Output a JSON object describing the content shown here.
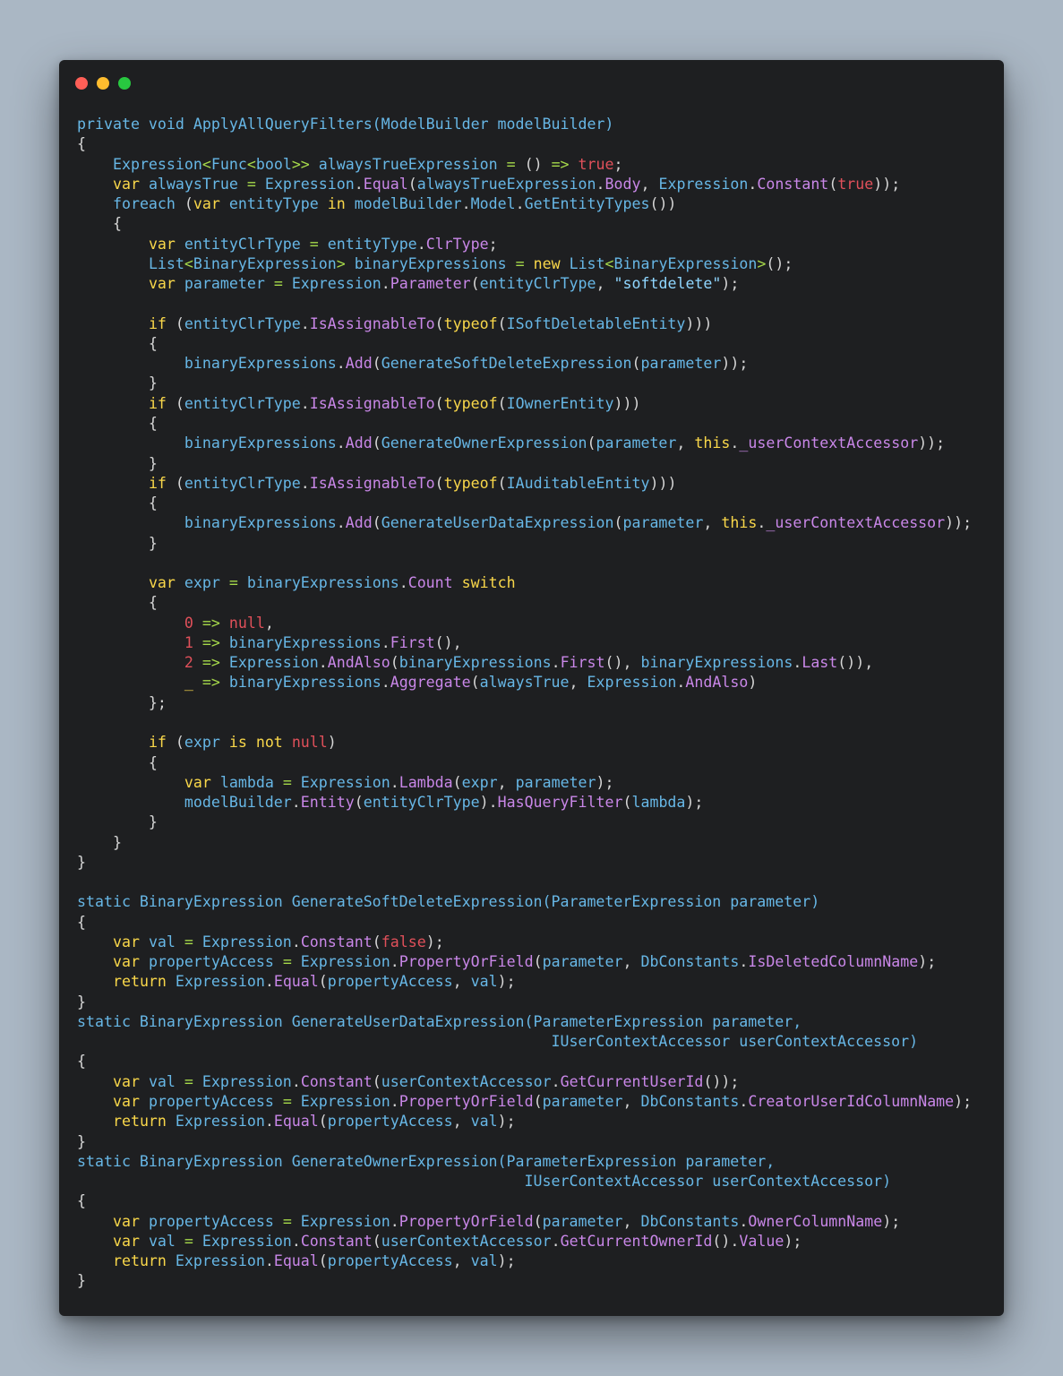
{
  "window": {
    "buttons": [
      {
        "name": "close",
        "color": "#ff5f57"
      },
      {
        "name": "minimize",
        "color": "#febc2e"
      },
      {
        "name": "maximize",
        "color": "#28c840"
      }
    ]
  },
  "theme": {
    "k": "#f9d74a",
    "t": "#67b7e6",
    "m": "#c987e8",
    "b": "#e0505a",
    "g": "#a6d94a",
    "s": "#8fd6ff",
    "p": "#d6d6d6"
  },
  "code": [
    [
      [
        "t",
        "private void ApplyAllQueryFilters(ModelBuilder modelBuilder)"
      ]
    ],
    [
      [
        "p",
        "{"
      ]
    ],
    [
      [
        "p",
        "    "
      ],
      [
        "t",
        "Expression"
      ],
      [
        "g",
        "<"
      ],
      [
        "t",
        "Func"
      ],
      [
        "g",
        "<"
      ],
      [
        "t",
        "bool"
      ],
      [
        "g",
        ">>"
      ],
      [
        "t",
        " alwaysTrueExpression "
      ],
      [
        "g",
        "="
      ],
      [
        "p",
        " () "
      ],
      [
        "g",
        "=>"
      ],
      [
        "p",
        " "
      ],
      [
        "b",
        "true"
      ],
      [
        "p",
        ";"
      ]
    ],
    [
      [
        "p",
        "    "
      ],
      [
        "k",
        "var"
      ],
      [
        "t",
        " alwaysTrue "
      ],
      [
        "g",
        "="
      ],
      [
        "t",
        " Expression"
      ],
      [
        "p",
        "."
      ],
      [
        "m",
        "Equal"
      ],
      [
        "p",
        "("
      ],
      [
        "t",
        "alwaysTrueExpression"
      ],
      [
        "p",
        "."
      ],
      [
        "m",
        "Body"
      ],
      [
        "p",
        ", "
      ],
      [
        "t",
        "Expression"
      ],
      [
        "p",
        "."
      ],
      [
        "m",
        "Constant"
      ],
      [
        "p",
        "("
      ],
      [
        "b",
        "true"
      ],
      [
        "p",
        "));"
      ]
    ],
    [
      [
        "p",
        "    "
      ],
      [
        "t",
        "foreach"
      ],
      [
        "p",
        " ("
      ],
      [
        "k",
        "var"
      ],
      [
        "t",
        " entityType "
      ],
      [
        "k",
        "in"
      ],
      [
        "t",
        " modelBuilder"
      ],
      [
        "p",
        "."
      ],
      [
        "t",
        "Model"
      ],
      [
        "p",
        "."
      ],
      [
        "t",
        "GetEntityTypes"
      ],
      [
        "p",
        "())"
      ]
    ],
    [
      [
        "p",
        "    {"
      ]
    ],
    [
      [
        "p",
        "        "
      ],
      [
        "k",
        "var"
      ],
      [
        "t",
        " entityClrType "
      ],
      [
        "g",
        "="
      ],
      [
        "t",
        " entityType"
      ],
      [
        "p",
        "."
      ],
      [
        "m",
        "ClrType"
      ],
      [
        "p",
        ";"
      ]
    ],
    [
      [
        "p",
        "        "
      ],
      [
        "t",
        "List"
      ],
      [
        "g",
        "<"
      ],
      [
        "t",
        "BinaryExpression"
      ],
      [
        "g",
        ">"
      ],
      [
        "t",
        " binaryExpressions "
      ],
      [
        "g",
        "="
      ],
      [
        "p",
        " "
      ],
      [
        "k",
        "new"
      ],
      [
        "p",
        " "
      ],
      [
        "t",
        "List"
      ],
      [
        "g",
        "<"
      ],
      [
        "t",
        "BinaryExpression"
      ],
      [
        "g",
        ">"
      ],
      [
        "p",
        "();"
      ]
    ],
    [
      [
        "p",
        "        "
      ],
      [
        "k",
        "var"
      ],
      [
        "t",
        " parameter "
      ],
      [
        "g",
        "="
      ],
      [
        "t",
        " Expression"
      ],
      [
        "p",
        "."
      ],
      [
        "m",
        "Parameter"
      ],
      [
        "p",
        "("
      ],
      [
        "t",
        "entityClrType"
      ],
      [
        "p",
        ", "
      ],
      [
        "s",
        "\"softdelete\""
      ],
      [
        "p",
        ");"
      ]
    ],
    [
      [
        "p",
        ""
      ]
    ],
    [
      [
        "p",
        "        "
      ],
      [
        "k",
        "if"
      ],
      [
        "p",
        " ("
      ],
      [
        "t",
        "entityClrType"
      ],
      [
        "p",
        "."
      ],
      [
        "m",
        "IsAssignableTo"
      ],
      [
        "p",
        "("
      ],
      [
        "k",
        "typeof"
      ],
      [
        "p",
        "("
      ],
      [
        "t",
        "ISoftDeletableEntity"
      ],
      [
        "p",
        ")))"
      ]
    ],
    [
      [
        "p",
        "        {"
      ]
    ],
    [
      [
        "p",
        "            "
      ],
      [
        "t",
        "binaryExpressions"
      ],
      [
        "p",
        "."
      ],
      [
        "m",
        "Add"
      ],
      [
        "p",
        "("
      ],
      [
        "t",
        "GenerateSoftDeleteExpression"
      ],
      [
        "p",
        "("
      ],
      [
        "t",
        "parameter"
      ],
      [
        "p",
        "));"
      ]
    ],
    [
      [
        "p",
        "        }"
      ]
    ],
    [
      [
        "p",
        "        "
      ],
      [
        "k",
        "if"
      ],
      [
        "p",
        " ("
      ],
      [
        "t",
        "entityClrType"
      ],
      [
        "p",
        "."
      ],
      [
        "m",
        "IsAssignableTo"
      ],
      [
        "p",
        "("
      ],
      [
        "k",
        "typeof"
      ],
      [
        "p",
        "("
      ],
      [
        "t",
        "IOwnerEntity"
      ],
      [
        "p",
        ")))"
      ]
    ],
    [
      [
        "p",
        "        {"
      ]
    ],
    [
      [
        "p",
        "            "
      ],
      [
        "t",
        "binaryExpressions"
      ],
      [
        "p",
        "."
      ],
      [
        "m",
        "Add"
      ],
      [
        "p",
        "("
      ],
      [
        "t",
        "GenerateOwnerExpression"
      ],
      [
        "p",
        "("
      ],
      [
        "t",
        "parameter"
      ],
      [
        "p",
        ", "
      ],
      [
        "k",
        "this"
      ],
      [
        "p",
        "."
      ],
      [
        "m",
        "_userContextAccessor"
      ],
      [
        "p",
        "));"
      ]
    ],
    [
      [
        "p",
        "        }"
      ]
    ],
    [
      [
        "p",
        "        "
      ],
      [
        "k",
        "if"
      ],
      [
        "p",
        " ("
      ],
      [
        "t",
        "entityClrType"
      ],
      [
        "p",
        "."
      ],
      [
        "m",
        "IsAssignableTo"
      ],
      [
        "p",
        "("
      ],
      [
        "k",
        "typeof"
      ],
      [
        "p",
        "("
      ],
      [
        "t",
        "IAuditableEntity"
      ],
      [
        "p",
        ")))"
      ]
    ],
    [
      [
        "p",
        "        {"
      ]
    ],
    [
      [
        "p",
        "            "
      ],
      [
        "t",
        "binaryExpressions"
      ],
      [
        "p",
        "."
      ],
      [
        "m",
        "Add"
      ],
      [
        "p",
        "("
      ],
      [
        "t",
        "GenerateUserDataExpression"
      ],
      [
        "p",
        "("
      ],
      [
        "t",
        "parameter"
      ],
      [
        "p",
        ", "
      ],
      [
        "k",
        "this"
      ],
      [
        "p",
        "."
      ],
      [
        "m",
        "_userContextAccessor"
      ],
      [
        "p",
        "));"
      ]
    ],
    [
      [
        "p",
        "        }"
      ]
    ],
    [
      [
        "p",
        ""
      ]
    ],
    [
      [
        "p",
        "        "
      ],
      [
        "k",
        "var"
      ],
      [
        "t",
        " expr "
      ],
      [
        "g",
        "="
      ],
      [
        "t",
        " binaryExpressions"
      ],
      [
        "p",
        "."
      ],
      [
        "m",
        "Count"
      ],
      [
        "p",
        " "
      ],
      [
        "k",
        "switch"
      ]
    ],
    [
      [
        "p",
        "        {"
      ]
    ],
    [
      [
        "p",
        "            "
      ],
      [
        "b",
        "0"
      ],
      [
        "p",
        " "
      ],
      [
        "g",
        "=>"
      ],
      [
        "p",
        " "
      ],
      [
        "b",
        "null"
      ],
      [
        "p",
        ","
      ]
    ],
    [
      [
        "p",
        "            "
      ],
      [
        "b",
        "1"
      ],
      [
        "p",
        " "
      ],
      [
        "g",
        "=>"
      ],
      [
        "t",
        " binaryExpressions"
      ],
      [
        "p",
        "."
      ],
      [
        "m",
        "First"
      ],
      [
        "p",
        "(),"
      ]
    ],
    [
      [
        "p",
        "            "
      ],
      [
        "b",
        "2"
      ],
      [
        "p",
        " "
      ],
      [
        "g",
        "=>"
      ],
      [
        "t",
        " Expression"
      ],
      [
        "p",
        "."
      ],
      [
        "m",
        "AndAlso"
      ],
      [
        "p",
        "("
      ],
      [
        "t",
        "binaryExpressions"
      ],
      [
        "p",
        "."
      ],
      [
        "m",
        "First"
      ],
      [
        "p",
        "(), "
      ],
      [
        "t",
        "binaryExpressions"
      ],
      [
        "p",
        "."
      ],
      [
        "m",
        "Last"
      ],
      [
        "p",
        "()),"
      ]
    ],
    [
      [
        "p",
        "            "
      ],
      [
        "k",
        "_"
      ],
      [
        "p",
        " "
      ],
      [
        "g",
        "=>"
      ],
      [
        "t",
        " binaryExpressions"
      ],
      [
        "p",
        "."
      ],
      [
        "m",
        "Aggregate"
      ],
      [
        "p",
        "("
      ],
      [
        "t",
        "alwaysTrue"
      ],
      [
        "p",
        ", "
      ],
      [
        "t",
        "Expression"
      ],
      [
        "p",
        "."
      ],
      [
        "m",
        "AndAlso"
      ],
      [
        "p",
        ")"
      ]
    ],
    [
      [
        "p",
        "        };"
      ]
    ],
    [
      [
        "p",
        ""
      ]
    ],
    [
      [
        "p",
        "        "
      ],
      [
        "k",
        "if"
      ],
      [
        "p",
        " ("
      ],
      [
        "t",
        "expr "
      ],
      [
        "k",
        "is not"
      ],
      [
        "p",
        " "
      ],
      [
        "b",
        "null"
      ],
      [
        "p",
        ")"
      ]
    ],
    [
      [
        "p",
        "        {"
      ]
    ],
    [
      [
        "p",
        "            "
      ],
      [
        "k",
        "var"
      ],
      [
        "t",
        " lambda "
      ],
      [
        "g",
        "="
      ],
      [
        "t",
        " Expression"
      ],
      [
        "p",
        "."
      ],
      [
        "m",
        "Lambda"
      ],
      [
        "p",
        "("
      ],
      [
        "t",
        "expr"
      ],
      [
        "p",
        ", "
      ],
      [
        "t",
        "parameter"
      ],
      [
        "p",
        ");"
      ]
    ],
    [
      [
        "p",
        "            "
      ],
      [
        "t",
        "modelBuilder"
      ],
      [
        "p",
        "."
      ],
      [
        "m",
        "Entity"
      ],
      [
        "p",
        "("
      ],
      [
        "t",
        "entityClrType"
      ],
      [
        "p",
        ")."
      ],
      [
        "m",
        "HasQueryFilter"
      ],
      [
        "p",
        "("
      ],
      [
        "t",
        "lambda"
      ],
      [
        "p",
        ");"
      ]
    ],
    [
      [
        "p",
        "        }"
      ]
    ],
    [
      [
        "p",
        "    }"
      ]
    ],
    [
      [
        "p",
        "}"
      ]
    ],
    [
      [
        "p",
        ""
      ]
    ],
    [
      [
        "t",
        "static BinaryExpression GenerateSoftDeleteExpression(ParameterExpression parameter)"
      ]
    ],
    [
      [
        "p",
        "{"
      ]
    ],
    [
      [
        "p",
        "    "
      ],
      [
        "k",
        "var"
      ],
      [
        "t",
        " val "
      ],
      [
        "g",
        "="
      ],
      [
        "t",
        " Expression"
      ],
      [
        "p",
        "."
      ],
      [
        "m",
        "Constant"
      ],
      [
        "p",
        "("
      ],
      [
        "b",
        "false"
      ],
      [
        "p",
        ");"
      ]
    ],
    [
      [
        "p",
        "    "
      ],
      [
        "k",
        "var"
      ],
      [
        "t",
        " propertyAccess "
      ],
      [
        "g",
        "="
      ],
      [
        "t",
        " Expression"
      ],
      [
        "p",
        "."
      ],
      [
        "m",
        "PropertyOrField"
      ],
      [
        "p",
        "("
      ],
      [
        "t",
        "parameter"
      ],
      [
        "p",
        ", "
      ],
      [
        "t",
        "DbConstants"
      ],
      [
        "p",
        "."
      ],
      [
        "m",
        "IsDeletedColumnName"
      ],
      [
        "p",
        ");"
      ]
    ],
    [
      [
        "p",
        "    "
      ],
      [
        "k",
        "return"
      ],
      [
        "t",
        " Expression"
      ],
      [
        "p",
        "."
      ],
      [
        "m",
        "Equal"
      ],
      [
        "p",
        "("
      ],
      [
        "t",
        "propertyAccess"
      ],
      [
        "p",
        ", "
      ],
      [
        "t",
        "val"
      ],
      [
        "p",
        ");"
      ]
    ],
    [
      [
        "p",
        "}"
      ]
    ],
    [
      [
        "t",
        "static BinaryExpression GenerateUserDataExpression(ParameterExpression parameter,"
      ]
    ],
    [
      [
        "t",
        "                                                     IUserContextAccessor userContextAccessor)"
      ]
    ],
    [
      [
        "p",
        "{"
      ]
    ],
    [
      [
        "p",
        "    "
      ],
      [
        "k",
        "var"
      ],
      [
        "t",
        " val "
      ],
      [
        "g",
        "="
      ],
      [
        "t",
        " Expression"
      ],
      [
        "p",
        "."
      ],
      [
        "m",
        "Constant"
      ],
      [
        "p",
        "("
      ],
      [
        "t",
        "userContextAccessor"
      ],
      [
        "p",
        "."
      ],
      [
        "m",
        "GetCurrentUserId"
      ],
      [
        "p",
        "());"
      ]
    ],
    [
      [
        "p",
        "    "
      ],
      [
        "k",
        "var"
      ],
      [
        "t",
        " propertyAccess "
      ],
      [
        "g",
        "="
      ],
      [
        "t",
        " Expression"
      ],
      [
        "p",
        "."
      ],
      [
        "m",
        "PropertyOrField"
      ],
      [
        "p",
        "("
      ],
      [
        "t",
        "parameter"
      ],
      [
        "p",
        ", "
      ],
      [
        "t",
        "DbConstants"
      ],
      [
        "p",
        "."
      ],
      [
        "m",
        "CreatorUserIdColumnName"
      ],
      [
        "p",
        ");"
      ]
    ],
    [
      [
        "p",
        "    "
      ],
      [
        "k",
        "return"
      ],
      [
        "t",
        " Expression"
      ],
      [
        "p",
        "."
      ],
      [
        "m",
        "Equal"
      ],
      [
        "p",
        "("
      ],
      [
        "t",
        "propertyAccess"
      ],
      [
        "p",
        ", "
      ],
      [
        "t",
        "val"
      ],
      [
        "p",
        ");"
      ]
    ],
    [
      [
        "p",
        "}"
      ]
    ],
    [
      [
        "t",
        "static BinaryExpression GenerateOwnerExpression(ParameterExpression parameter,"
      ]
    ],
    [
      [
        "t",
        "                                                  IUserContextAccessor userContextAccessor)"
      ]
    ],
    [
      [
        "p",
        "{"
      ]
    ],
    [
      [
        "p",
        "    "
      ],
      [
        "k",
        "var"
      ],
      [
        "t",
        " propertyAccess "
      ],
      [
        "g",
        "="
      ],
      [
        "t",
        " Expression"
      ],
      [
        "p",
        "."
      ],
      [
        "m",
        "PropertyOrField"
      ],
      [
        "p",
        "("
      ],
      [
        "t",
        "parameter"
      ],
      [
        "p",
        ", "
      ],
      [
        "t",
        "DbConstants"
      ],
      [
        "p",
        "."
      ],
      [
        "m",
        "OwnerColumnName"
      ],
      [
        "p",
        ");"
      ]
    ],
    [
      [
        "p",
        "    "
      ],
      [
        "k",
        "var"
      ],
      [
        "t",
        " val "
      ],
      [
        "g",
        "="
      ],
      [
        "t",
        " Expression"
      ],
      [
        "p",
        "."
      ],
      [
        "m",
        "Constant"
      ],
      [
        "p",
        "("
      ],
      [
        "t",
        "userContextAccessor"
      ],
      [
        "p",
        "."
      ],
      [
        "m",
        "GetCurrentOwnerId"
      ],
      [
        "p",
        "()."
      ],
      [
        "m",
        "Value"
      ],
      [
        "p",
        ");"
      ]
    ],
    [
      [
        "p",
        "    "
      ],
      [
        "k",
        "return"
      ],
      [
        "t",
        " Expression"
      ],
      [
        "p",
        "."
      ],
      [
        "m",
        "Equal"
      ],
      [
        "p",
        "("
      ],
      [
        "t",
        "propertyAccess"
      ],
      [
        "p",
        ", "
      ],
      [
        "t",
        "val"
      ],
      [
        "p",
        ");"
      ]
    ],
    [
      [
        "p",
        "}"
      ]
    ]
  ]
}
